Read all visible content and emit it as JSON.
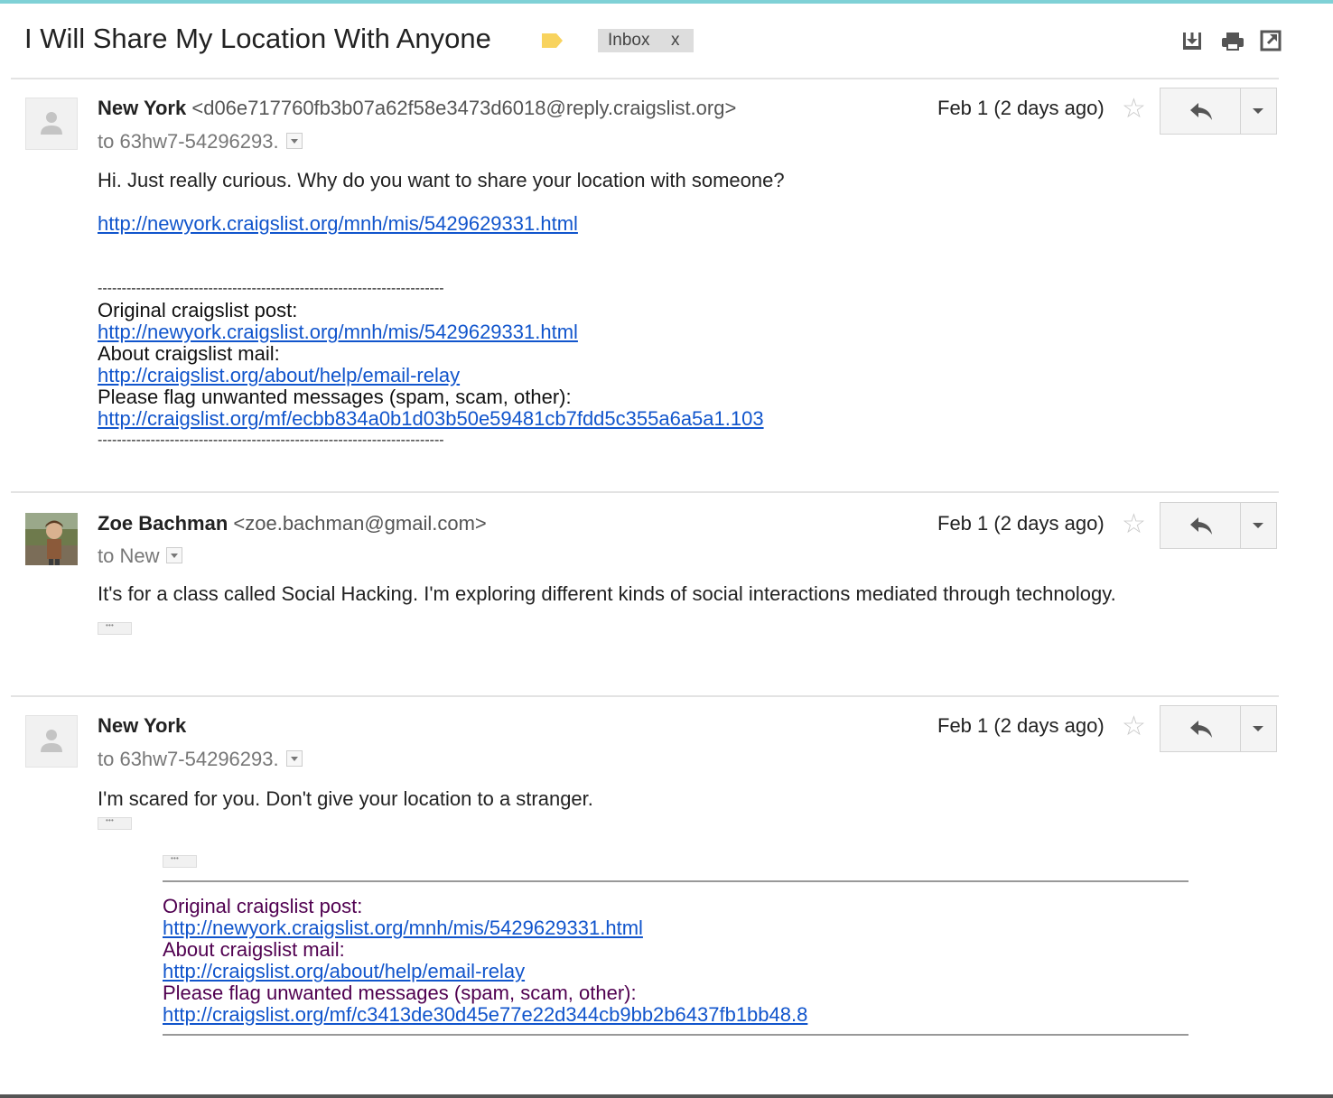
{
  "thread": {
    "subject": "I Will Share My Location With Anyone",
    "label_chip": "Inbox",
    "label_close": "x",
    "icons": [
      "download-icon",
      "print-icon",
      "new-window-icon"
    ]
  },
  "messages": [
    {
      "sender_name": "New York",
      "sender_email": "<d06e717760fb3b07a62f58e3473d6018@reply.craigslist.org>",
      "to": "to 63hw7-54296293.",
      "date": "Feb 1 (2 days ago)",
      "body": "Hi. Just really curious. Why do you want to share your location with someone?",
      "link": "http://newyork.craigslist.org/mnh/mis/5429629331.html",
      "dashes": "------------------------------------------------------------------------",
      "footer": {
        "orig_label": "Original craigslist post:",
        "orig_link": "http://newyork.craigslist.org/mnh/mis/5429629331.html",
        "about_label": "About craigslist mail:",
        "about_link": "http://craigslist.org/about/help/email-relay",
        "flag_label": "Please flag unwanted messages (spam, scam, other):",
        "flag_link": "http://craigslist.org/mf/ecbb834a0b1d03b50e59481cb7fdd5c355a6a5a1.103"
      }
    },
    {
      "sender_name": "Zoe Bachman",
      "sender_email": "<zoe.bachman@gmail.com>",
      "to": "to New",
      "date": "Feb 1 (2 days ago)",
      "body": "It's for a class called Social Hacking. I'm exploring different kinds of social interactions mediated through technology."
    },
    {
      "sender_name": "New York",
      "to": "to 63hw7-54296293.",
      "date": "Feb 1 (2 days ago)",
      "body": "I'm scared for you. Don't give your location to a stranger.",
      "quote": {
        "orig_label": "Original craigslist post:",
        "orig_link": "http://newyork.craigslist.org/mnh/mis/5429629331.html",
        "about_label": "About craigslist mail:",
        "about_link": "http://craigslist.org/about/help/email-relay",
        "flag_label": "Please flag unwanted messages (spam, scam, other):",
        "flag_link": "http://craigslist.org/mf/c3413de30d45e77e22d344cb9bb2b6437fb1bb48.8"
      }
    }
  ],
  "colors": {
    "link": "#1155cc",
    "quoted_text": "#500050",
    "label_tag": "#f8d35e",
    "chip_bg": "#dddddd"
  }
}
